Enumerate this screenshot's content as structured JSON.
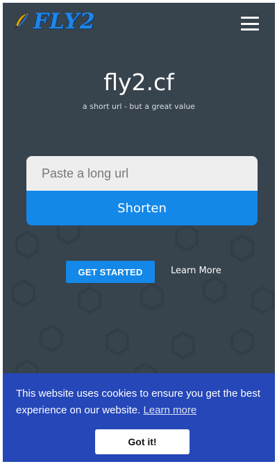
{
  "header": {
    "logo_text": "FLY2",
    "logo_icon": "quill-pen-icon",
    "menu_icon": "hamburger-menu-icon"
  },
  "hero": {
    "title": "fly2.cf",
    "tagline": "a short url - but a great value"
  },
  "url_form": {
    "input_value": "",
    "input_placeholder": "Paste a long url",
    "submit_label": "Shorten"
  },
  "actions": {
    "get_started_label": "GET STARTED",
    "learn_more_label": "Learn More"
  },
  "cookie_banner": {
    "message": "This website uses cookies to ensure you get the best experience on our website.",
    "link_label": "Learn more",
    "accept_label": "Got it!"
  },
  "colors": {
    "background": "#37434d",
    "accent": "#1388e8",
    "cookie_banner": "#2547b8"
  }
}
